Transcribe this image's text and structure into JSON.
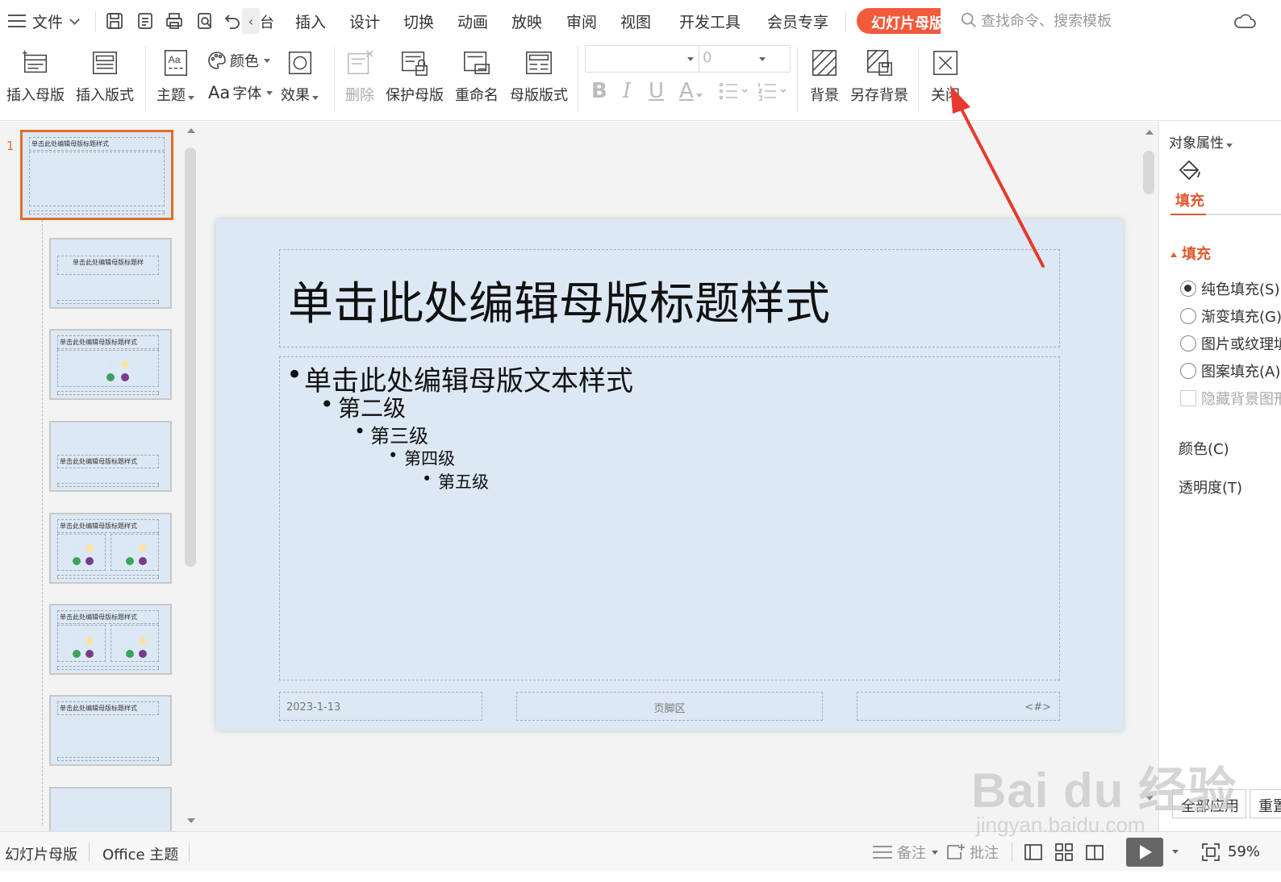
{
  "menubar": {
    "file_label": "文件",
    "tab_partial": "台",
    "tabs": [
      "插入",
      "设计",
      "切换",
      "动画",
      "放映",
      "审阅",
      "视图",
      "开发工具",
      "会员专享"
    ],
    "active_tab": "幻灯片母版",
    "search_placeholder": "查找命令、搜索模板"
  },
  "ribbon": {
    "insert_master": "插入母版",
    "insert_layout": "插入版式",
    "theme": "主题",
    "color": "颜色",
    "font_prefix": "Aa",
    "font": "字体",
    "effect": "效果",
    "delete": "删除",
    "protect_master": "保护母版",
    "rename": "重命名",
    "master_layout": "母版版式",
    "font_size": "0",
    "background": "背景",
    "save_background": "另存背景",
    "close": "关闭"
  },
  "thumbnails": {
    "first_number": "1",
    "items": [
      {
        "title": "单击此处编辑母版标题样式"
      },
      {
        "title": "单击此处编辑母版标题样"
      },
      {
        "title": "单击此处编辑母版标题样式"
      },
      {
        "title": "单击此处编辑母版标题样式"
      },
      {
        "title": "单击此处编辑母版标题样式"
      },
      {
        "title": "单击此处编辑母版标题样式"
      },
      {
        "title": "单击此处编辑母版标题样式"
      }
    ]
  },
  "slide": {
    "title": "单击此处编辑母版标题样式",
    "level1": "单击此处编辑母版文本样式",
    "level2": "第二级",
    "level3": "第三级",
    "level4": "第四级",
    "level5": "第五级",
    "date": "2023-1-13",
    "footer": "页脚区",
    "slide_number": "<#>"
  },
  "right_panel": {
    "title": "对象属性",
    "tab": "填充",
    "section": "填充",
    "options": [
      "纯色填充(S)",
      "渐变填充(G)",
      "图片或纹理填充(P)",
      "图案填充(A)"
    ],
    "selected_option": 0,
    "hide_bg": "隐藏背景图形",
    "color_label": "颜色(C)",
    "transparency_label": "透明度(T)",
    "apply_all": "全部应用",
    "reset": "重置背景"
  },
  "statusbar": {
    "mode": "幻灯片母版",
    "theme": "Office 主题",
    "notes": "备注",
    "comments": "批注",
    "zoom": "59%"
  },
  "watermark": {
    "brand": "Bai du 经验",
    "url": "jingyan.baidu.com"
  },
  "colors": {
    "accent": "#f25a3c",
    "selected_thumb": "#e06d2b",
    "slide_bg": "#dde8f5",
    "annotation_arrow": "#e8392c"
  }
}
